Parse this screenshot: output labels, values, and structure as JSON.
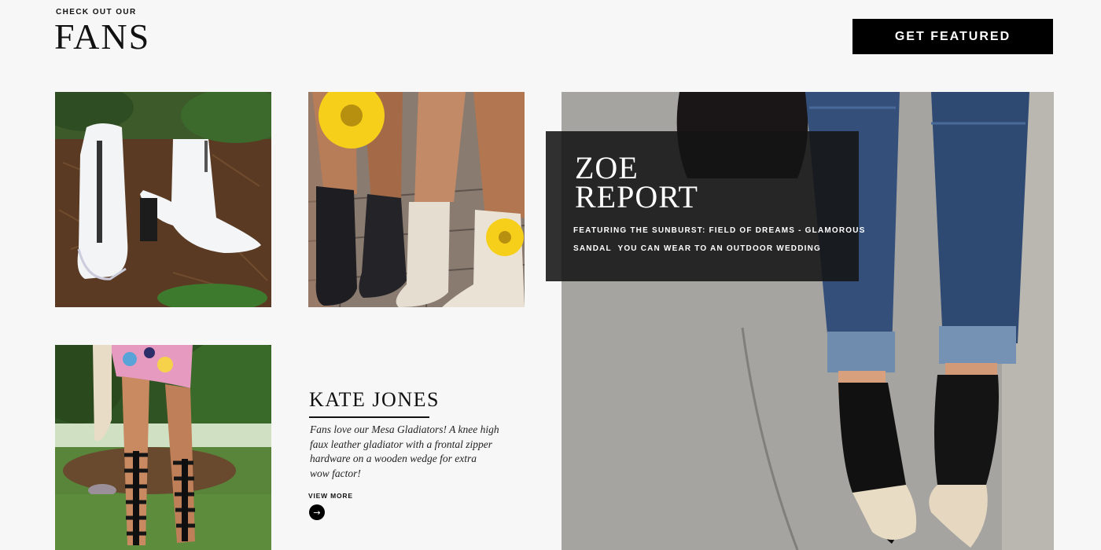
{
  "header": {
    "kicker": "CHECK OUT OUR",
    "title": "FANS",
    "cta_label": "GET FEATURED"
  },
  "feature": {
    "title_line1": "ZOE",
    "title_line2": "REPORT",
    "caption_line1": "FEATURING THE SUNBURST: FIELD OF DREAMS - GLAMOROUS",
    "caption_line2": "SANDAL  YOU CAN WEAR TO AN OUTDOOR WEDDING"
  },
  "fan": {
    "name": "KATE JONES",
    "description_lines": [
      "Fans love our Mesa Gladiators! A knee high",
      "faux leather gladiator with a frontal zipper",
      "hardware on a wooden wedge for extra",
      "wow factor!"
    ],
    "view_more_label": "VIEW MORE",
    "arrow_icon": "arrow-right-icon"
  },
  "colors": {
    "background": "#f7f7f7",
    "cta_background": "#000000",
    "overlay_background": "rgba(20,20,20,0.88)"
  }
}
